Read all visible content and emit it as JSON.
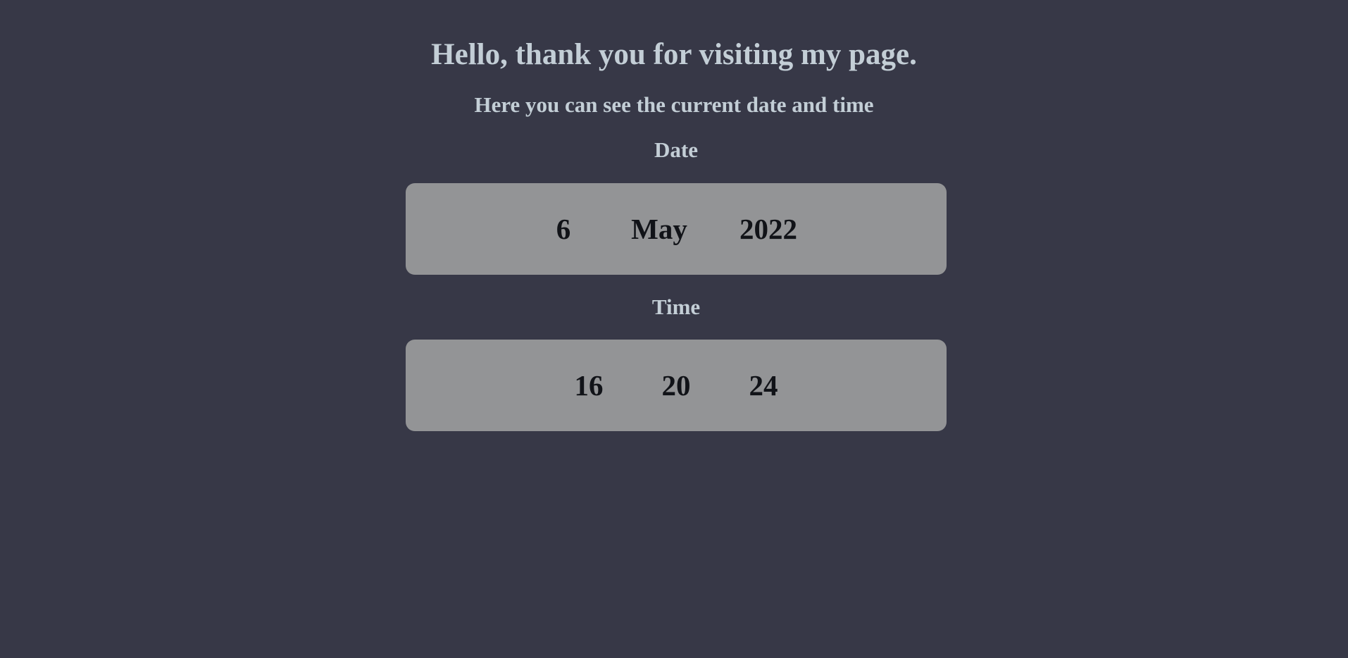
{
  "header": {
    "greeting": "Hello, thank you for visiting my page.",
    "subtitle": "Here you can see the current date and time"
  },
  "date": {
    "label": "Date",
    "day": "6",
    "month": "May",
    "year": "2022"
  },
  "time": {
    "label": "Time",
    "hours": "16",
    "minutes": "20",
    "seconds": "24"
  },
  "colors": {
    "background": "#373847",
    "heading_text": "#c3ced6",
    "box_background": "#939496",
    "box_text": "#111318"
  }
}
